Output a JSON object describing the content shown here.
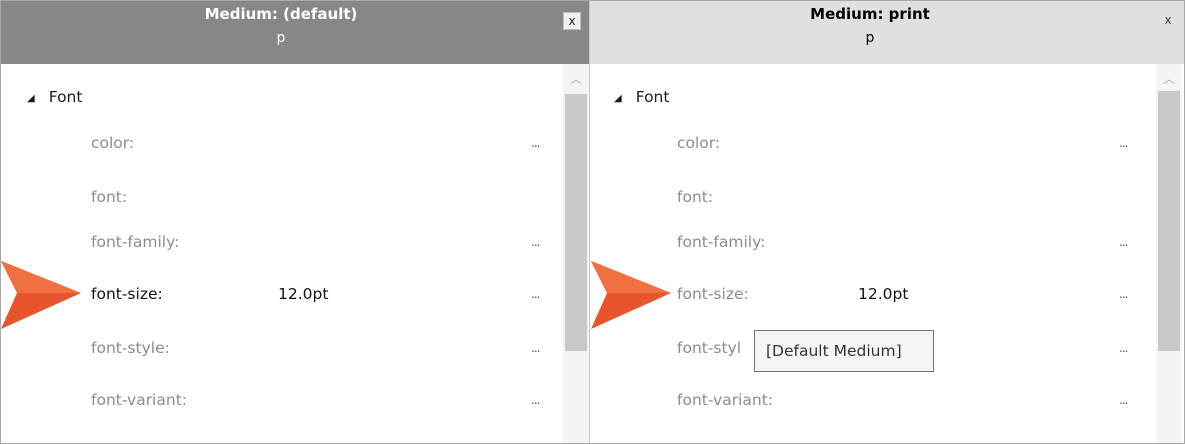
{
  "left_pane": {
    "title": "Medium: (default)",
    "subtitle": "p",
    "close_label": "x",
    "category": "Font",
    "properties": [
      {
        "name": "color:",
        "value": "",
        "more": "..."
      },
      {
        "name": "font:",
        "value": "",
        "more": ""
      },
      {
        "name": "font-family:",
        "value": "",
        "more": "..."
      },
      {
        "name": "font-size:",
        "value": "12.0pt",
        "more": "..."
      },
      {
        "name": "font-style:",
        "value": "",
        "more": "..."
      },
      {
        "name": "font-variant:",
        "value": "",
        "more": "..."
      }
    ]
  },
  "right_pane": {
    "title": "Medium: print",
    "subtitle": "p",
    "close_label": "x",
    "category": "Font",
    "properties": [
      {
        "name": "color:",
        "value": "",
        "more": "..."
      },
      {
        "name": "font:",
        "value": "",
        "more": ""
      },
      {
        "name": "font-family:",
        "value": "",
        "more": "..."
      },
      {
        "name": "font-size:",
        "value": "12.0pt",
        "more": "..."
      },
      {
        "name": "font-styl",
        "value": "",
        "more": "..."
      },
      {
        "name": "font-variant:",
        "value": "",
        "more": "..."
      }
    ]
  },
  "tooltip": {
    "text": "[Default Medium]"
  },
  "icons": {
    "expand": "triangle-down-icon",
    "scroll_up": "chevron-up-icon",
    "pointer": "callout-arrow-icon"
  },
  "colors": {
    "left_header_bg": "#878787",
    "right_header_bg": "#e0e0e0",
    "callout_arrow": "#e8542c"
  }
}
